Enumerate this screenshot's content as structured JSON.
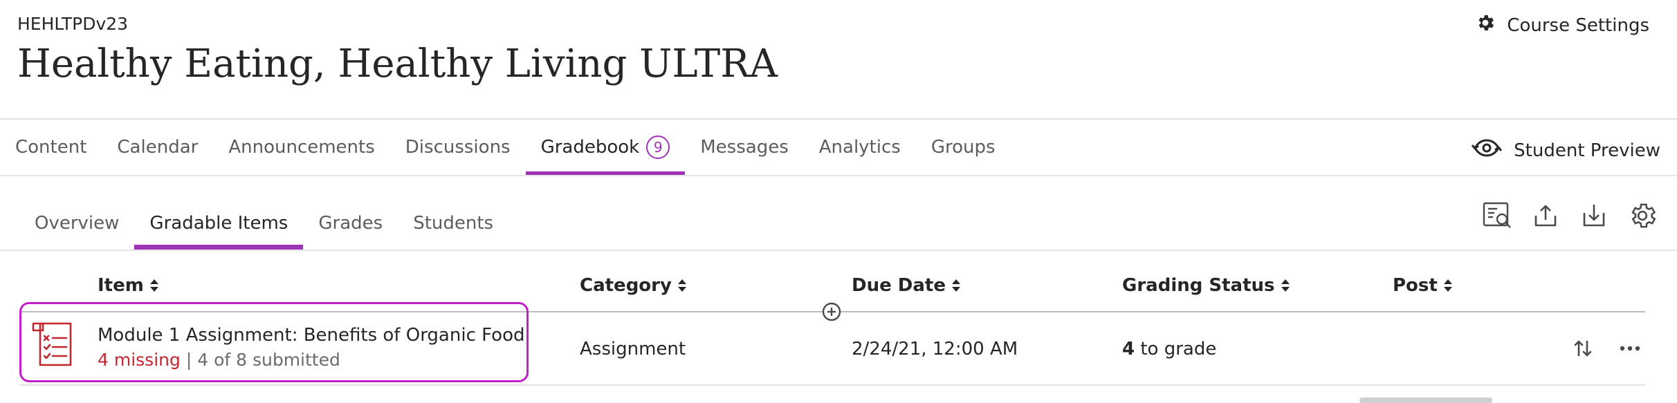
{
  "course": {
    "code": "HEHLTPDv23",
    "title": "Healthy Eating, Healthy Living ULTRA",
    "settings_label": "Course Settings"
  },
  "main_nav": {
    "tabs": [
      {
        "label": "Content"
      },
      {
        "label": "Calendar"
      },
      {
        "label": "Announcements"
      },
      {
        "label": "Discussions"
      },
      {
        "label": "Gradebook",
        "badge": "9",
        "active": true
      },
      {
        "label": "Messages"
      },
      {
        "label": "Analytics"
      },
      {
        "label": "Groups"
      }
    ],
    "student_preview_label": "Student Preview"
  },
  "sub_nav": {
    "tabs": [
      {
        "label": "Overview"
      },
      {
        "label": "Gradable Items",
        "active": true
      },
      {
        "label": "Grades"
      },
      {
        "label": "Students"
      }
    ]
  },
  "toolbar": {
    "icons": [
      "grading-review-icon",
      "export-icon",
      "download-icon",
      "gear-icon"
    ]
  },
  "table": {
    "headers": {
      "item": "Item",
      "category": "Category",
      "due_date": "Due Date",
      "grading_status": "Grading Status",
      "post": "Post"
    },
    "rows": [
      {
        "title": "Module 1 Assignment: Benefits of Organic Food",
        "missing": "4 missing",
        "separator": "|",
        "submitted": "4 of 8 submitted",
        "category": "Assignment",
        "due_date": "2/24/21, 12:00 AM",
        "to_grade_count": "4",
        "to_grade_label": "to grade"
      }
    ]
  },
  "colors": {
    "accent": "#a033b5",
    "highlight_border": "#c21ec9",
    "missing": "#c4262e",
    "assignment_icon": "#c4262e"
  }
}
